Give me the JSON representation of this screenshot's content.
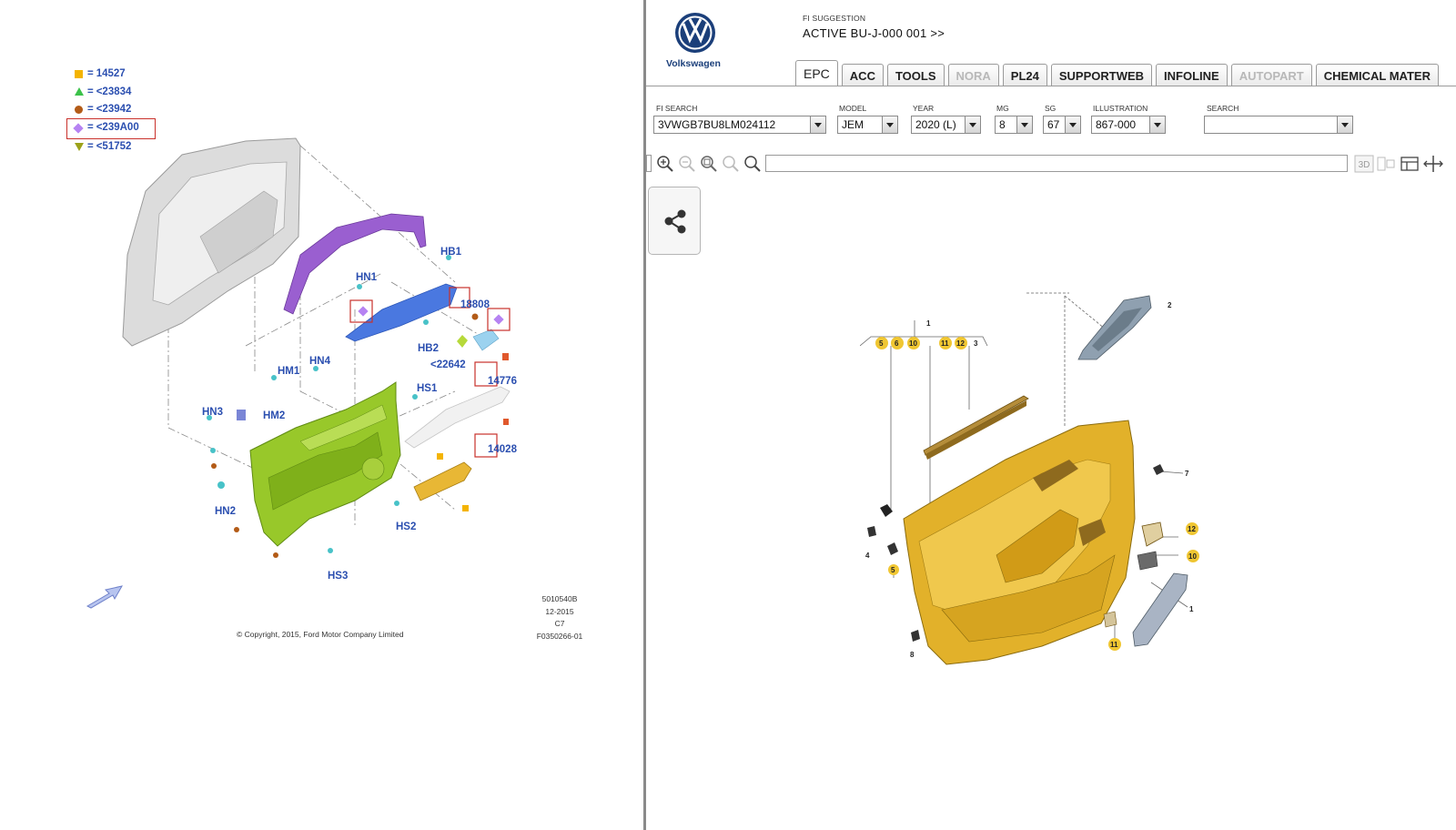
{
  "left": {
    "legend": [
      {
        "symbol": "square",
        "text": "14527",
        "boxed": false,
        "color": "#f4b400"
      },
      {
        "symbol": "triangle",
        "text": "<23834",
        "boxed": false,
        "color": "#3cc24a"
      },
      {
        "symbol": "circle",
        "text": "<23942",
        "boxed": false,
        "color": "#b35b17"
      },
      {
        "symbol": "diamond",
        "text": "<239A00",
        "boxed": true,
        "color": "#b683f2"
      },
      {
        "symbol": "triangle-down",
        "text": "<51752",
        "boxed": false,
        "color": "#9ca21a"
      }
    ],
    "callouts": {
      "hb1": "HB1",
      "hn1": "HN1",
      "c18808": "18808",
      "hb2": "HB2",
      "c22642": "<22642",
      "hn4": "HN4",
      "hm1": "HM1",
      "c14776": "14776",
      "hs1": "HS1",
      "hn3": "HN3",
      "hm2": "HM2",
      "c14028": "14028",
      "hn2": "HN2",
      "hs2": "HS2",
      "hs3": "HS3"
    },
    "meta": {
      "code": "5010540B",
      "date": "12-2015",
      "sheet": "C7",
      "figure": "F0350266-01"
    },
    "copyright": "© Copyright, 2015, Ford Motor Company Limited"
  },
  "right": {
    "brand": "Volkswagen",
    "fi_suggestion_label": "FI SUGGESTION",
    "fi_active": "ACTIVE  BU-J-000 001 >>",
    "tabs": [
      {
        "label": "EPC",
        "state": "active"
      },
      {
        "label": "ACC",
        "state": "normal"
      },
      {
        "label": "TOOLS",
        "state": "normal"
      },
      {
        "label": "NORA",
        "state": "disabled"
      },
      {
        "label": "PL24",
        "state": "normal"
      },
      {
        "label": "SUPPORTWEB",
        "state": "normal"
      },
      {
        "label": "INFOLINE",
        "state": "normal"
      },
      {
        "label": "AUTOPART",
        "state": "disabled"
      },
      {
        "label": "CHEMICAL MATER",
        "state": "normal"
      }
    ],
    "fields": {
      "fi_search": {
        "label": "FI SEARCH",
        "value": "3VWGB7BU8LM024112"
      },
      "model": {
        "label": "MODEL",
        "value": "JEM"
      },
      "year": {
        "label": "YEAR",
        "value": "2020 (L)"
      },
      "mg": {
        "label": "MG",
        "value": "8"
      },
      "sg": {
        "label": "SG",
        "value": "67"
      },
      "illustration": {
        "label": "ILLUSTRATION",
        "value": "867-000"
      },
      "search": {
        "label": "SEARCH",
        "value": ""
      }
    },
    "toolbar": {
      "icons": [
        "zoom-in-icon",
        "zoom-out-icon",
        "zoom-area-icon",
        "pan-icon",
        "search-icon",
        "3d-icon",
        "split-view-icon",
        "layout-icon",
        "fit-icon"
      ],
      "three_d": "3D"
    },
    "callouts": {
      "n1": "1",
      "n2": "2",
      "n3": "3",
      "n4": "4",
      "n5": "5",
      "n6": "6",
      "n7": "7",
      "n8": "8",
      "n10": "10",
      "n11": "11",
      "n12": "12",
      "n5b": "5",
      "n10b": "10",
      "n11b": "11",
      "n12b": "12"
    }
  }
}
